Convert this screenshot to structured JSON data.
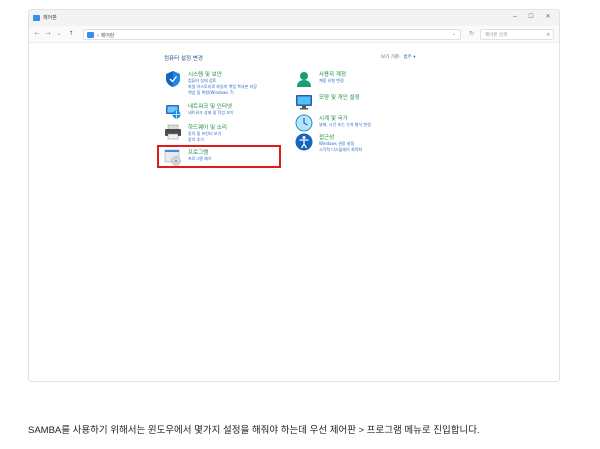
{
  "window": {
    "title": "제어판",
    "minimize": "−",
    "maximize": "☐",
    "close": "✕"
  },
  "nav": {
    "back": "←",
    "forward": "→",
    "recent": "⌄",
    "up": "↑"
  },
  "address": {
    "crumb": "› 제어판",
    "dropdown": "⌄",
    "refresh": "↻"
  },
  "search": {
    "placeholder": "제어판 검색",
    "icon": "⌕"
  },
  "content": {
    "heading": "컴퓨터 설정 변경",
    "view_by_label": "보기 기준:",
    "view_by_value": "범주 ▾"
  },
  "left_categories": [
    {
      "title": "시스템 및 보안",
      "links": [
        "컴퓨터 상태 검토",
        "파일 히스토리로 파일의 백업 복사본 저장",
        "백업 및 복원(Windows 7)"
      ]
    },
    {
      "title": "네트워크 및 인터넷",
      "links": [
        "네트워크 상태 및 작업 보기"
      ]
    },
    {
      "title": "하드웨어 및 소리",
      "links": [
        "장치 및 프린터 보기",
        "장치 추가"
      ]
    },
    {
      "title": "프로그램",
      "links": [
        "프로그램 제거"
      ]
    }
  ],
  "right_categories": [
    {
      "title": "사용자 계정",
      "links": [
        "계정 유형 변경"
      ]
    },
    {
      "title": "모양 및 개인 설정",
      "links": []
    },
    {
      "title": "시계 및 국가",
      "links": [
        "날짜, 시간 또는 숫자 형식 변경"
      ]
    },
    {
      "title": "접근성",
      "links": [
        "Windows 권장 설정",
        "시각적 디스플레이 최적화"
      ]
    }
  ],
  "caption": "SAMBA를 사용하기 위해서는 윈도우에서 몇가지 설정을 해줘야 하는데 우선 제어판 > 프로그램 메뉴로 진입합니다."
}
